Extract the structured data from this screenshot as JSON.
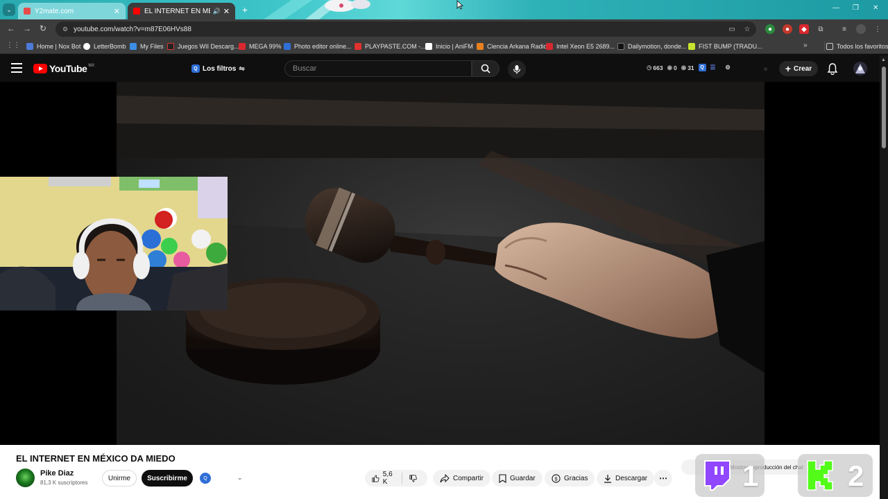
{
  "browser": {
    "tabs": [
      {
        "title": "Y2mate.com",
        "color": "#e84a4a"
      },
      {
        "title": "EL INTERNET EN MÉXICO D",
        "color": "#ff0000"
      }
    ],
    "url": "youtube.com/watch?v=m87E06HVs88",
    "bookmarks": [
      {
        "label": "Home | Nox Bot",
        "color": "#4c7bd9"
      },
      {
        "label": "LetterBomb",
        "color": "#ffffff"
      },
      {
        "label": "My Files",
        "color": "#3a8ee6"
      },
      {
        "label": "Juegos WII Descarg...",
        "color": "#222222"
      },
      {
        "label": "MEGA 99%",
        "color": "#d9272e"
      },
      {
        "label": "Photo editor online...",
        "color": "#2f6fd6"
      },
      {
        "label": "PLAYPASTE.COM -...",
        "color": "#e0322e"
      },
      {
        "label": "Inicio | AniFM",
        "color": "#ffffff"
      },
      {
        "label": "Ciencia Arkana Radio",
        "color": "#e8801f"
      },
      {
        "label": "Intel Xeon E5 2689...",
        "color": "#d9272e"
      },
      {
        "label": "Dailymotion, donde...",
        "color": "#111111"
      },
      {
        "label": "FIST BUMP (TRADU...",
        "color": "#c7e32e"
      }
    ],
    "all_bookmarks": "Todos los favoritos"
  },
  "youtube": {
    "logo_text": "YouTube",
    "country": "MX",
    "filters_label": "Los filtros",
    "search_placeholder": "Buscar",
    "stats": {
      "a": "663",
      "b": "0",
      "c": "31"
    },
    "create_label": "Crear"
  },
  "video": {
    "title": "EL INTERNET EN MÉXICO DA MIEDO",
    "channel": "Pike Diaz",
    "subscribers": "81,3 K suscriptores",
    "join_label": "Unirme",
    "subscribe_label": "Suscribirme",
    "likes": "5,6 K",
    "share_label": "Compartir",
    "save_label": "Guardar",
    "thanks_label": "Gracias",
    "download_label": "Descargar",
    "replay_text": "Mostrar reproducción del chat"
  },
  "overlays": {
    "twitch_count": "1",
    "kick_count": "2"
  },
  "colors": {
    "youtube_red": "#ff0000",
    "twitch_purple": "#9146ff",
    "kick_green": "#53fc18"
  }
}
